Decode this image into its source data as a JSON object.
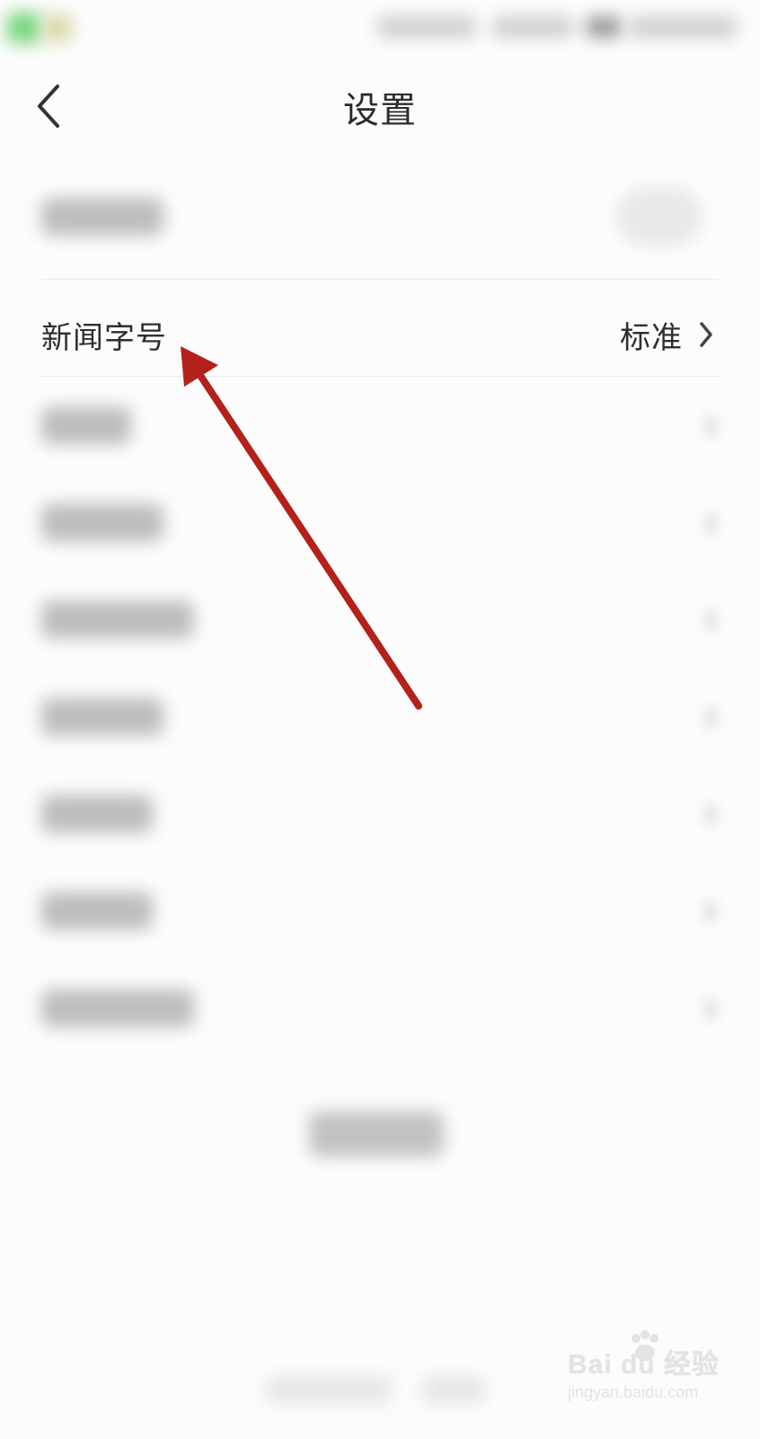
{
  "header": {
    "title": "设置",
    "back_icon": "chevron-left-icon"
  },
  "font_size_row": {
    "label": "新闻字号",
    "value": "标准",
    "chevron_icon": "chevron-right-icon"
  },
  "annotation": {
    "color": "#b3211a",
    "icon": "arrow-icon"
  },
  "watermark": {
    "brand": "Bai du 经验",
    "url": "jingyan.baidu.com"
  }
}
